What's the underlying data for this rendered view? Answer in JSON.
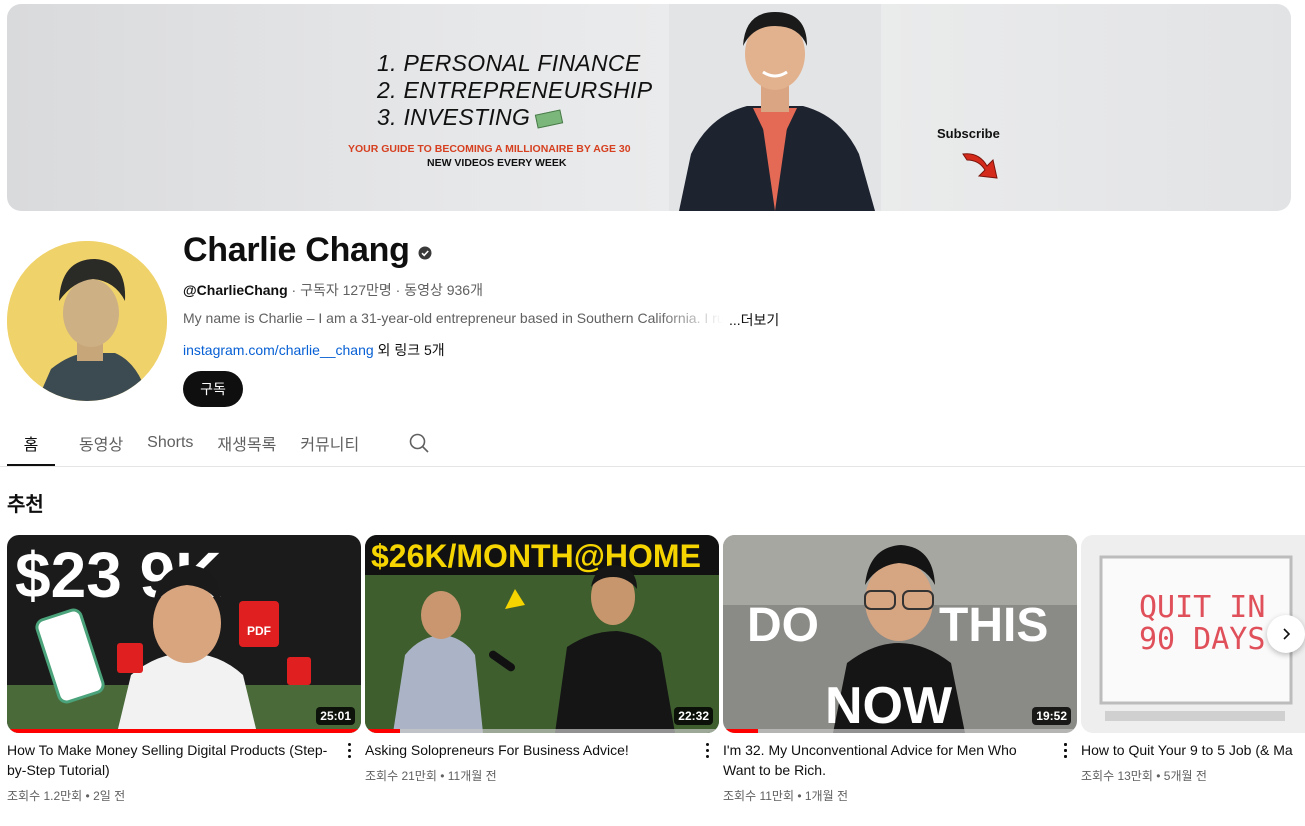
{
  "banner": {
    "items": [
      "1. PERSONAL FINANCE",
      "2. ENTREPRENEURSHIP",
      "3. INVESTING"
    ],
    "guide": "YOUR GUIDE TO BECOMING A MILLIONAIRE BY AGE 30",
    "schedule": "NEW VIDEOS EVERY WEEK",
    "subscribe": "Subscribe"
  },
  "channel": {
    "name": "Charlie Chang",
    "handle": "@CharlieChang",
    "subscribers": " · 구독자 127만명 · 동영상 936개",
    "description": "My name is Charlie – I am a 31-year-old entrepreneur based in Southern California. I run",
    "more": "...더보기",
    "link": "instagram.com/charlie__chang",
    "other_links": " 외 링크 5개",
    "subscribe_label": "구독"
  },
  "tabs": [
    "홈",
    "동영상",
    "Shorts",
    "재생목록",
    "커뮤니티"
  ],
  "section_title": "추천",
  "videos": [
    {
      "title": "How To Make Money Selling Digital Products (Step-by-Step Tutorial)",
      "views": "조회수 1.2만회",
      "age": "2일 전",
      "duration": "25:01",
      "thumb_text": "$23⁠9K",
      "progress": 1.0
    },
    {
      "title": "Asking Solopreneurs For Business Advice!",
      "views": "조회수 21만회",
      "age": "11개월 전",
      "duration": "22:32",
      "thumb_text": "$26K/MONTH@HOME",
      "progress": 0.1
    },
    {
      "title": "I'm 32. My Unconventional Advice for Men Who Want to be Rich.",
      "views": "조회수 11만회",
      "age": "1개월 전",
      "duration": "19:52",
      "thumb_text_1": "DO",
      "thumb_text_2": "THIS",
      "thumb_text_3": "NOW",
      "progress": 0.1
    },
    {
      "title": "How to Quit Your 9 to 5 Job (& Ma",
      "views": "조회수 13만회",
      "age": "5개월 전",
      "thumb_text_1": "QUIT IN",
      "thumb_text_2": "90 DAYS"
    }
  ],
  "colors": {
    "accent": "#ff0000",
    "link": "#065fd4",
    "text": "#0f0f0f",
    "secondary": "#606060"
  }
}
